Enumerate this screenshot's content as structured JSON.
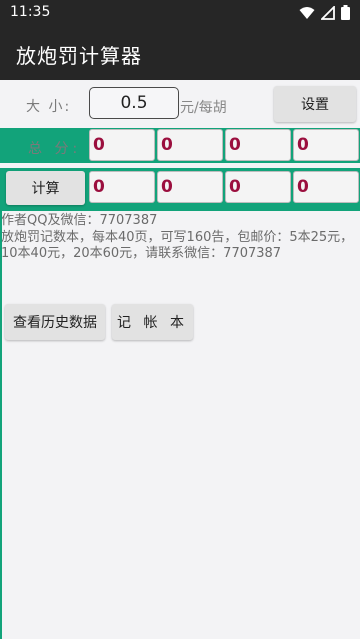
{
  "status_bar": {
    "time": "11:35"
  },
  "app": {
    "title": "放炮罚计算器"
  },
  "size_row": {
    "label": "大 小:",
    "value": "0.5",
    "unit": "元/每胡",
    "settings_label": "设置"
  },
  "total_row": {
    "label": "总 分:",
    "values": [
      "0",
      "0",
      "0",
      "0"
    ]
  },
  "calc_row": {
    "button_label": "计算",
    "values": [
      "0",
      "0",
      "0",
      "0"
    ]
  },
  "info": {
    "line1": "作者QQ及微信：7707387",
    "line2": "放炮罚记数本，每本40页，可写160告，包邮价：5本25元，10本40元，20本60元，请联系微信：7707387"
  },
  "actions": {
    "history_label": "查看历史数据",
    "ledger_label": "记 帐 本"
  },
  "colors": {
    "accent": "#12a37a",
    "score": "#9b0f3e",
    "appbar": "#262626"
  }
}
